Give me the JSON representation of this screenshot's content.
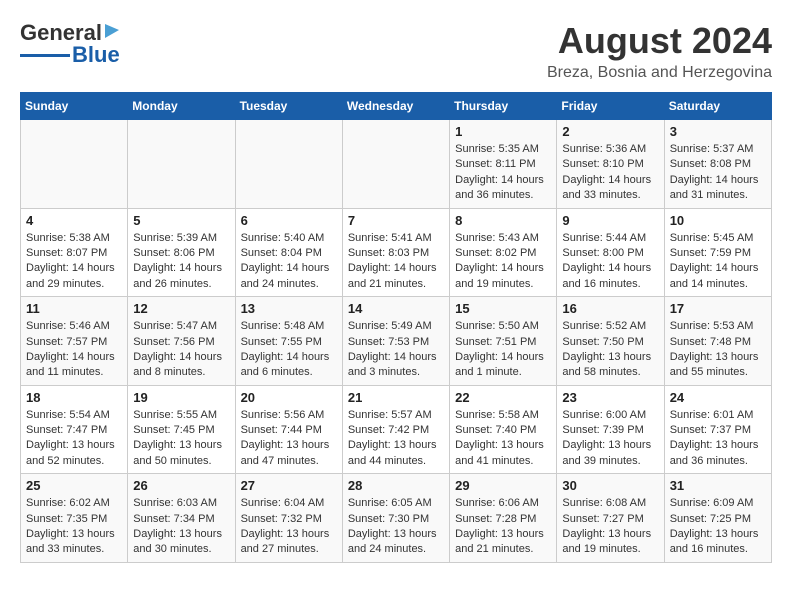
{
  "header": {
    "logo_general": "General",
    "logo_blue": "Blue",
    "main_title": "August 2024",
    "sub_title": "Breza, Bosnia and Herzegovina"
  },
  "days_of_week": [
    "Sunday",
    "Monday",
    "Tuesday",
    "Wednesday",
    "Thursday",
    "Friday",
    "Saturday"
  ],
  "weeks": [
    [
      {
        "day": "",
        "info": ""
      },
      {
        "day": "",
        "info": ""
      },
      {
        "day": "",
        "info": ""
      },
      {
        "day": "",
        "info": ""
      },
      {
        "day": "1",
        "info": "Sunrise: 5:35 AM\nSunset: 8:11 PM\nDaylight: 14 hours\nand 36 minutes."
      },
      {
        "day": "2",
        "info": "Sunrise: 5:36 AM\nSunset: 8:10 PM\nDaylight: 14 hours\nand 33 minutes."
      },
      {
        "day": "3",
        "info": "Sunrise: 5:37 AM\nSunset: 8:08 PM\nDaylight: 14 hours\nand 31 minutes."
      }
    ],
    [
      {
        "day": "4",
        "info": "Sunrise: 5:38 AM\nSunset: 8:07 PM\nDaylight: 14 hours\nand 29 minutes."
      },
      {
        "day": "5",
        "info": "Sunrise: 5:39 AM\nSunset: 8:06 PM\nDaylight: 14 hours\nand 26 minutes."
      },
      {
        "day": "6",
        "info": "Sunrise: 5:40 AM\nSunset: 8:04 PM\nDaylight: 14 hours\nand 24 minutes."
      },
      {
        "day": "7",
        "info": "Sunrise: 5:41 AM\nSunset: 8:03 PM\nDaylight: 14 hours\nand 21 minutes."
      },
      {
        "day": "8",
        "info": "Sunrise: 5:43 AM\nSunset: 8:02 PM\nDaylight: 14 hours\nand 19 minutes."
      },
      {
        "day": "9",
        "info": "Sunrise: 5:44 AM\nSunset: 8:00 PM\nDaylight: 14 hours\nand 16 minutes."
      },
      {
        "day": "10",
        "info": "Sunrise: 5:45 AM\nSunset: 7:59 PM\nDaylight: 14 hours\nand 14 minutes."
      }
    ],
    [
      {
        "day": "11",
        "info": "Sunrise: 5:46 AM\nSunset: 7:57 PM\nDaylight: 14 hours\nand 11 minutes."
      },
      {
        "day": "12",
        "info": "Sunrise: 5:47 AM\nSunset: 7:56 PM\nDaylight: 14 hours\nand 8 minutes."
      },
      {
        "day": "13",
        "info": "Sunrise: 5:48 AM\nSunset: 7:55 PM\nDaylight: 14 hours\nand 6 minutes."
      },
      {
        "day": "14",
        "info": "Sunrise: 5:49 AM\nSunset: 7:53 PM\nDaylight: 14 hours\nand 3 minutes."
      },
      {
        "day": "15",
        "info": "Sunrise: 5:50 AM\nSunset: 7:51 PM\nDaylight: 14 hours\nand 1 minute."
      },
      {
        "day": "16",
        "info": "Sunrise: 5:52 AM\nSunset: 7:50 PM\nDaylight: 13 hours\nand 58 minutes."
      },
      {
        "day": "17",
        "info": "Sunrise: 5:53 AM\nSunset: 7:48 PM\nDaylight: 13 hours\nand 55 minutes."
      }
    ],
    [
      {
        "day": "18",
        "info": "Sunrise: 5:54 AM\nSunset: 7:47 PM\nDaylight: 13 hours\nand 52 minutes."
      },
      {
        "day": "19",
        "info": "Sunrise: 5:55 AM\nSunset: 7:45 PM\nDaylight: 13 hours\nand 50 minutes."
      },
      {
        "day": "20",
        "info": "Sunrise: 5:56 AM\nSunset: 7:44 PM\nDaylight: 13 hours\nand 47 minutes."
      },
      {
        "day": "21",
        "info": "Sunrise: 5:57 AM\nSunset: 7:42 PM\nDaylight: 13 hours\nand 44 minutes."
      },
      {
        "day": "22",
        "info": "Sunrise: 5:58 AM\nSunset: 7:40 PM\nDaylight: 13 hours\nand 41 minutes."
      },
      {
        "day": "23",
        "info": "Sunrise: 6:00 AM\nSunset: 7:39 PM\nDaylight: 13 hours\nand 39 minutes."
      },
      {
        "day": "24",
        "info": "Sunrise: 6:01 AM\nSunset: 7:37 PM\nDaylight: 13 hours\nand 36 minutes."
      }
    ],
    [
      {
        "day": "25",
        "info": "Sunrise: 6:02 AM\nSunset: 7:35 PM\nDaylight: 13 hours\nand 33 minutes."
      },
      {
        "day": "26",
        "info": "Sunrise: 6:03 AM\nSunset: 7:34 PM\nDaylight: 13 hours\nand 30 minutes."
      },
      {
        "day": "27",
        "info": "Sunrise: 6:04 AM\nSunset: 7:32 PM\nDaylight: 13 hours\nand 27 minutes."
      },
      {
        "day": "28",
        "info": "Sunrise: 6:05 AM\nSunset: 7:30 PM\nDaylight: 13 hours\nand 24 minutes."
      },
      {
        "day": "29",
        "info": "Sunrise: 6:06 AM\nSunset: 7:28 PM\nDaylight: 13 hours\nand 21 minutes."
      },
      {
        "day": "30",
        "info": "Sunrise: 6:08 AM\nSunset: 7:27 PM\nDaylight: 13 hours\nand 19 minutes."
      },
      {
        "day": "31",
        "info": "Sunrise: 6:09 AM\nSunset: 7:25 PM\nDaylight: 13 hours\nand 16 minutes."
      }
    ]
  ]
}
